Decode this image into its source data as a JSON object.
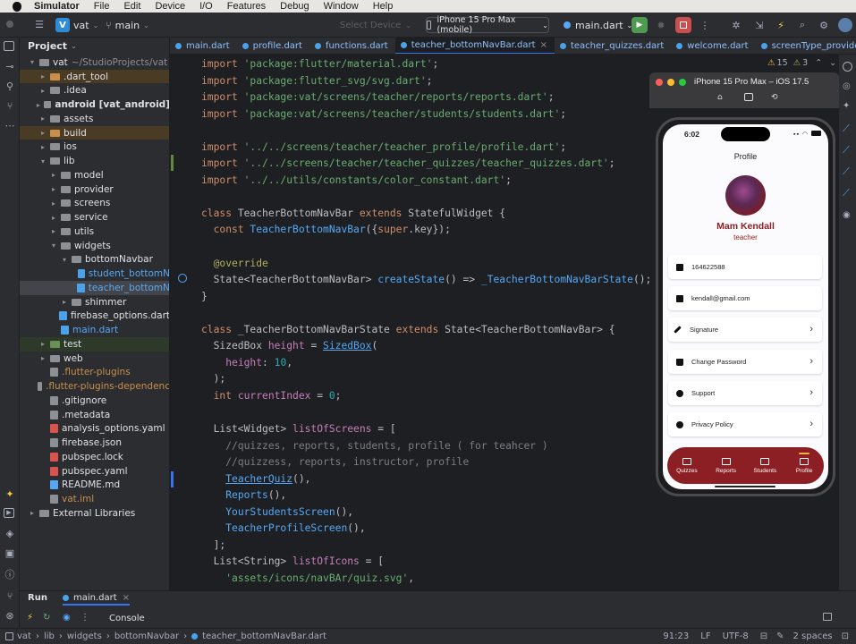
{
  "menubar": {
    "app": "Simulator",
    "items": [
      "File",
      "Edit",
      "Device",
      "I/O",
      "Features",
      "Debug",
      "Window",
      "Help"
    ]
  },
  "toolbar": {
    "project_badge": "V",
    "project_name": "vat",
    "branch": "main",
    "device_placeholder": "Select Device",
    "device": "iPhone 15 Pro Max (mobile)",
    "run_config": "main.dart"
  },
  "project_panel": {
    "title": "Project",
    "rows": [
      {
        "label": "vat",
        "suffix": "~/StudioProjects/vat",
        "indent": 1,
        "open": true,
        "kind": "folder"
      },
      {
        "label": ".dart_tool",
        "indent": 2,
        "kind": "folder-orange",
        "hl": "orange"
      },
      {
        "label": ".idea",
        "indent": 2,
        "kind": "folder"
      },
      {
        "label": "android [vat_android]",
        "indent": 2,
        "kind": "folder",
        "bold": true
      },
      {
        "label": "assets",
        "indent": 2,
        "kind": "folder"
      },
      {
        "label": "build",
        "indent": 2,
        "kind": "folder-orange",
        "hl": "orange"
      },
      {
        "label": "ios",
        "indent": 2,
        "kind": "folder"
      },
      {
        "label": "lib",
        "indent": 2,
        "open": true,
        "kind": "folder"
      },
      {
        "label": "model",
        "indent": 3,
        "kind": "folder"
      },
      {
        "label": "provider",
        "indent": 3,
        "kind": "folder"
      },
      {
        "label": "screens",
        "indent": 3,
        "kind": "folder"
      },
      {
        "label": "service",
        "indent": 3,
        "kind": "folder"
      },
      {
        "label": "utils",
        "indent": 3,
        "kind": "folder"
      },
      {
        "label": "widgets",
        "indent": 3,
        "open": true,
        "kind": "folder"
      },
      {
        "label": "bottomNavbar",
        "indent": 4,
        "open": true,
        "kind": "folder"
      },
      {
        "label": "student_bottomN",
        "indent": 5,
        "kind": "dart"
      },
      {
        "label": "teacher_bottomN",
        "indent": 5,
        "kind": "dart",
        "hl": "sel"
      },
      {
        "label": "shimmer",
        "indent": 4,
        "kind": "folder"
      },
      {
        "label": "firebase_options.dart",
        "indent": 3,
        "kind": "dart"
      },
      {
        "label": "main.dart",
        "indent": 3,
        "kind": "dart",
        "blue": true
      },
      {
        "label": "test",
        "indent": 2,
        "kind": "folder-green",
        "hl": "green"
      },
      {
        "label": "web",
        "indent": 2,
        "kind": "folder"
      },
      {
        "label": ".flutter-plugins",
        "indent": 2,
        "kind": "file",
        "orange": true
      },
      {
        "label": ".flutter-plugins-dependenc",
        "indent": 2,
        "kind": "file",
        "orange": true
      },
      {
        "label": ".gitignore",
        "indent": 2,
        "kind": "file"
      },
      {
        "label": ".metadata",
        "indent": 2,
        "kind": "file"
      },
      {
        "label": "analysis_options.yaml",
        "indent": 2,
        "kind": "yaml"
      },
      {
        "label": "firebase.json",
        "indent": 2,
        "kind": "json"
      },
      {
        "label": "pubspec.lock",
        "indent": 2,
        "kind": "yaml"
      },
      {
        "label": "pubspec.yaml",
        "indent": 2,
        "kind": "yaml"
      },
      {
        "label": "README.md",
        "indent": 2,
        "kind": "md"
      },
      {
        "label": "vat.iml",
        "indent": 2,
        "kind": "file",
        "orange": true
      },
      {
        "label": "External Libraries",
        "indent": 1,
        "kind": "folder"
      }
    ]
  },
  "tabs": [
    "main.dart",
    "profile.dart",
    "functions.dart",
    "teacher_bottomNavBar.dart",
    "teacher_quizzes.dart",
    "welcome.dart",
    "screenType_provider.c"
  ],
  "active_tab": 3,
  "inspection": {
    "warnings": "15",
    "weak": "3"
  },
  "code_lines": [
    [
      [
        "kw",
        "import "
      ],
      [
        "str",
        "'package:flutter/material.dart'"
      ],
      [
        "cls",
        ";"
      ]
    ],
    [
      [
        "kw",
        "import "
      ],
      [
        "str",
        "'package:flutter_svg/svg.dart'"
      ],
      [
        "cls",
        ";"
      ]
    ],
    [
      [
        "kw",
        "import "
      ],
      [
        "str",
        "'package:vat/screens/teacher/reports/reports.dart'"
      ],
      [
        "cls",
        ";"
      ]
    ],
    [
      [
        "kw",
        "import "
      ],
      [
        "str",
        "'package:vat/screens/teacher/students/students.dart'"
      ],
      [
        "cls",
        ";"
      ]
    ],
    [],
    [
      [
        "kw",
        "import "
      ],
      [
        "str",
        "'../../screens/teacher/teacher_profile/profile.dart'"
      ],
      [
        "cls",
        ";"
      ]
    ],
    [
      [
        "kw",
        "import "
      ],
      [
        "str",
        "'../../screens/teacher/teacher_quizzes/teacher_quizzes.dart'"
      ],
      [
        "cls",
        ";"
      ]
    ],
    [
      [
        "kw",
        "import "
      ],
      [
        "str",
        "'../../utils/constants/color_constant.dart'"
      ],
      [
        "cls",
        ";"
      ]
    ],
    [],
    [
      [
        "kw",
        "class "
      ],
      [
        "cls",
        "TeacherBottomNavBar "
      ],
      [
        "kw",
        "extends "
      ],
      [
        "cls",
        "StatefulWidget {"
      ]
    ],
    [
      [
        "cls",
        "  "
      ],
      [
        "kw",
        "const "
      ],
      [
        "fn",
        "TeacherBottomNavBar"
      ],
      [
        "cls",
        "({"
      ],
      [
        "kw",
        "super"
      ],
      [
        "cls",
        ".key});"
      ]
    ],
    [],
    [
      [
        "ann",
        "  @override"
      ]
    ],
    [
      [
        "cls",
        "  State<TeacherBottomNavBar> "
      ],
      [
        "fn",
        "createState"
      ],
      [
        "cls",
        "() => "
      ],
      [
        "fn",
        "_TeacherBottomNavBarState"
      ],
      [
        "cls",
        "();"
      ]
    ],
    [
      [
        "cls",
        "}"
      ]
    ],
    [],
    [
      [
        "kw",
        "class "
      ],
      [
        "cls",
        "_TeacherBottomNavBarState "
      ],
      [
        "kw",
        "extends "
      ],
      [
        "cls",
        "State<TeacherBottomNavBar> {"
      ]
    ],
    [
      [
        "cls",
        "  SizedBox "
      ],
      [
        "fld",
        "height"
      ],
      [
        "cls",
        " = "
      ],
      [
        "lnk",
        "SizedBox"
      ],
      [
        "cls",
        "("
      ]
    ],
    [
      [
        "cls",
        "    "
      ],
      [
        "fld",
        "height"
      ],
      [
        "cls",
        ": "
      ],
      [
        "num",
        "10"
      ],
      [
        "cls",
        ","
      ]
    ],
    [
      [
        "cls",
        "  );"
      ]
    ],
    [
      [
        "cls",
        "  "
      ],
      [
        "kw",
        "int "
      ],
      [
        "fld",
        "currentIndex"
      ],
      [
        "cls",
        " = "
      ],
      [
        "num",
        "0"
      ],
      [
        "cls",
        ";"
      ]
    ],
    [],
    [
      [
        "cls",
        "  List<Widget> "
      ],
      [
        "fld",
        "listOfScreens"
      ],
      [
        "cls",
        " = ["
      ]
    ],
    [
      [
        "com",
        "    //quizzes, reports, students, profile ( for teahcer )"
      ]
    ],
    [
      [
        "com",
        "    //quizzess, reports, instructor, profile"
      ]
    ],
    [
      [
        "cls",
        "    "
      ],
      [
        "lnk",
        "TeacherQuiz"
      ],
      [
        "cls",
        "(),"
      ]
    ],
    [
      [
        "cls",
        "    "
      ],
      [
        "fn",
        "Reports"
      ],
      [
        "cls",
        "(),"
      ]
    ],
    [
      [
        "cls",
        "    "
      ],
      [
        "fn",
        "YourStudentsScreen"
      ],
      [
        "cls",
        "(),"
      ]
    ],
    [
      [
        "cls",
        "    "
      ],
      [
        "fn",
        "TeacherProfileScreen"
      ],
      [
        "cls",
        "(),"
      ]
    ],
    [
      [
        "cls",
        "  ];"
      ]
    ],
    [
      [
        "cls",
        "  List<String> "
      ],
      [
        "fld",
        "listOfIcons"
      ],
      [
        "cls",
        " = ["
      ]
    ],
    [
      [
        "cls",
        "    "
      ],
      [
        "str",
        "'assets/icons/navBAr/quiz.svg'"
      ],
      [
        "cls",
        ","
      ]
    ]
  ],
  "simulator": {
    "title": "iPhone 15 Pro Max – iOS 17.5"
  },
  "phone": {
    "time": "6:02",
    "title": "Profile",
    "name": "Mam Kendall",
    "role": "teacher",
    "info": [
      {
        "icon": "card-icon",
        "text": "164622588"
      },
      {
        "icon": "mail-icon",
        "text": "kendall@gmail.com"
      }
    ],
    "menu": [
      {
        "icon": "pen-icon",
        "text": "Signature"
      },
      {
        "icon": "lock-icon",
        "text": "Change Password"
      },
      {
        "icon": "support-icon",
        "text": "Support"
      },
      {
        "icon": "info-icon",
        "text": "Privacy Policy"
      }
    ],
    "nav": [
      "Quizzes",
      "Reports",
      "Students",
      "Profile"
    ],
    "accent": "#8c1f24"
  },
  "bottom_panel": {
    "run_label": "Run",
    "run_tab": "main.dart",
    "console_label": "Console"
  },
  "statusbar": {
    "path": [
      "vat",
      "lib",
      "widgets",
      "bottomNavbar",
      "teacher_bottomNavBar.dart"
    ],
    "position": "91:23",
    "line_sep": "LF",
    "encoding": "UTF-8",
    "indent": "2 spaces"
  }
}
